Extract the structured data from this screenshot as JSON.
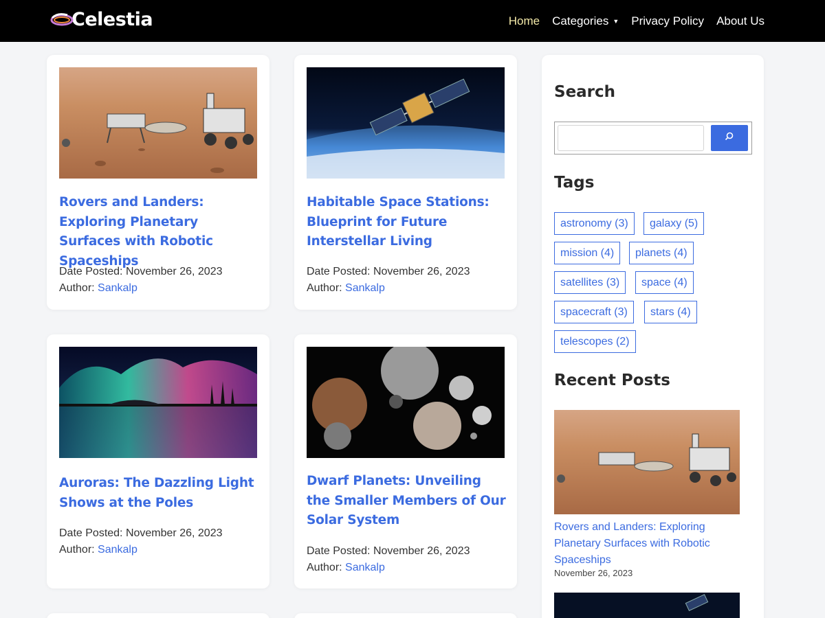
{
  "site": {
    "logo_text": "Celestia"
  },
  "nav": {
    "items": [
      {
        "label": "Home"
      },
      {
        "label": "Categories"
      },
      {
        "label": "Privacy Policy"
      },
      {
        "label": "About Us"
      }
    ]
  },
  "posts": [
    {
      "title": "Rovers and Landers: Exploring Planetary Surfaces with Robotic Spaceships",
      "date_label": "Date Posted:",
      "date": "November 26, 2023",
      "author_label": "Author:",
      "author": "Sankalp"
    },
    {
      "title": "Habitable Space Stations: Blueprint for Future Interstellar Living",
      "date_label": "Date Posted:",
      "date": "November 26, 2023",
      "author_label": "Author:",
      "author": "Sankalp"
    },
    {
      "title": "Auroras: The Dazzling Light Shows at the Poles",
      "date_label": "Date Posted:",
      "date": "November 26, 2023",
      "author_label": "Author:",
      "author": "Sankalp"
    },
    {
      "title": "Dwarf Planets: Unveiling the Smaller Members of Our Solar System",
      "date_label": "Date Posted:",
      "date": "November 26, 2023",
      "author_label": "Author:",
      "author": "Sankalp"
    }
  ],
  "sidebar": {
    "search_title": "Search",
    "tags_title": "Tags",
    "tags": [
      {
        "label": "astronomy (3)"
      },
      {
        "label": "galaxy (5)"
      },
      {
        "label": "mission (4)"
      },
      {
        "label": "planets (4)"
      },
      {
        "label": "satellites (3)"
      },
      {
        "label": "space (4)"
      },
      {
        "label": "spacecraft (3)"
      },
      {
        "label": "stars (4)"
      },
      {
        "label": "telescopes (2)"
      }
    ],
    "recent_title": "Recent Posts",
    "recent": [
      {
        "title": "Rovers and Landers: Exploring Planetary Surfaces with Robotic Spaceships",
        "date": "November 26, 2023"
      }
    ]
  },
  "colors": {
    "accent": "#3b6be0",
    "header_bg": "#000000",
    "active_nav": "#f3e9a8"
  }
}
